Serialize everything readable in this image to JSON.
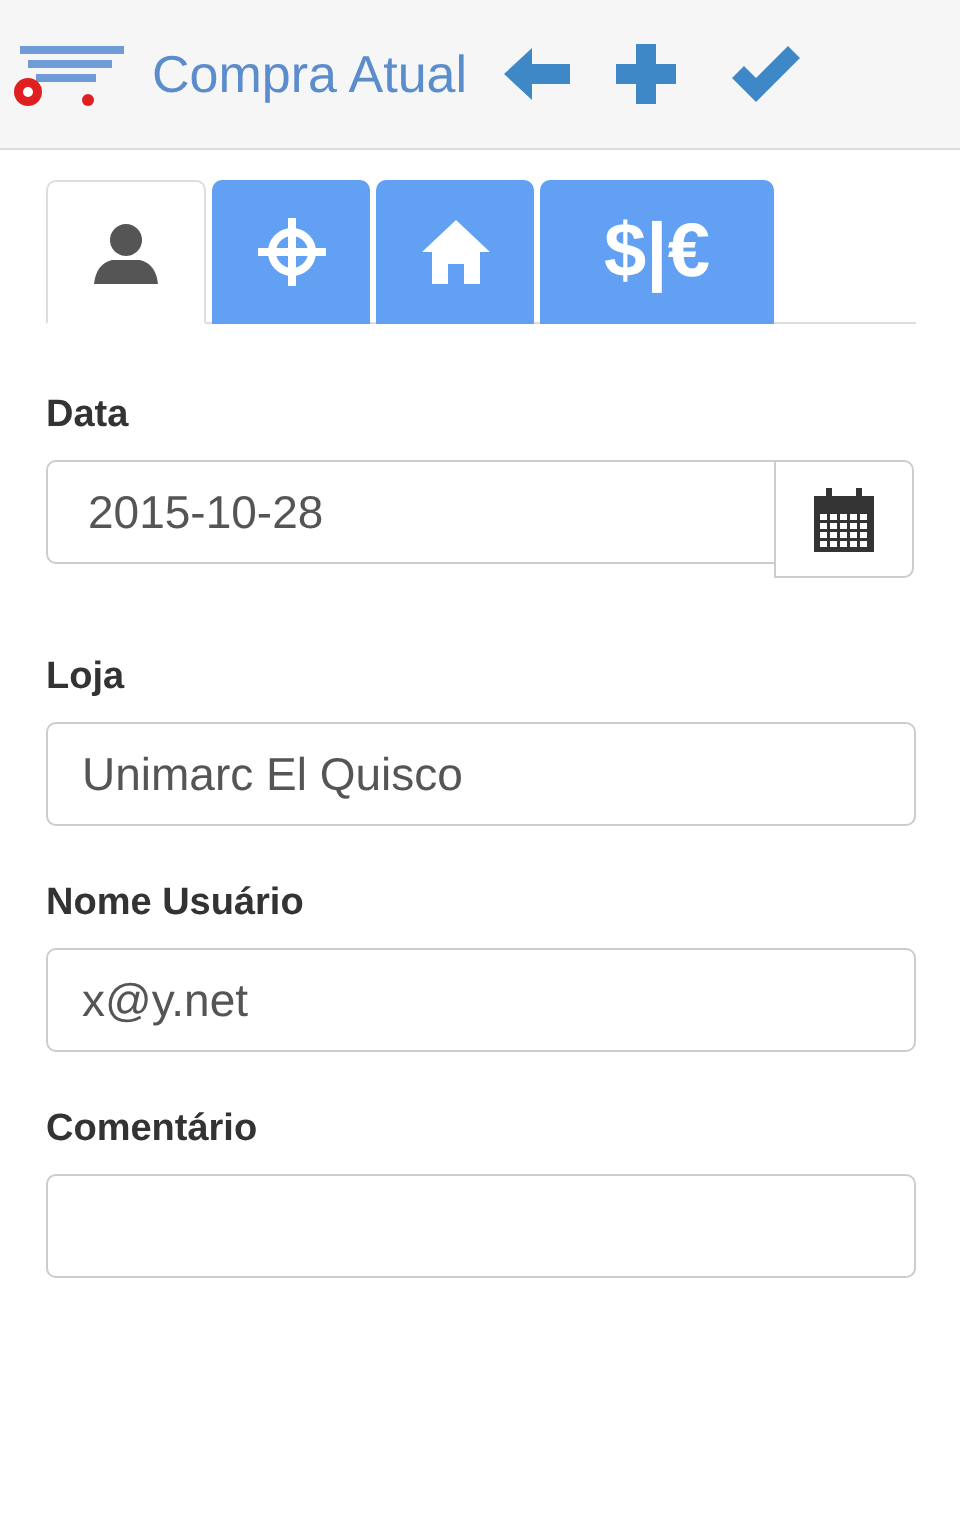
{
  "header": {
    "title": "Compra Atual"
  },
  "tabs": [
    {
      "kind": "person",
      "selected": true
    },
    {
      "kind": "target",
      "selected": false
    },
    {
      "kind": "home",
      "selected": false
    },
    {
      "kind": "text",
      "label": "$|€",
      "selected": false
    }
  ],
  "fields": [
    {
      "kind": "date",
      "label": "Data",
      "value": "2015-10-28"
    },
    {
      "kind": "text",
      "label": "Loja",
      "value": "Unimarc El Quisco"
    },
    {
      "kind": "text",
      "label": "Nome Usuário",
      "value": "x@y.net"
    },
    {
      "kind": "text",
      "label": "Comentário"
    }
  ]
}
